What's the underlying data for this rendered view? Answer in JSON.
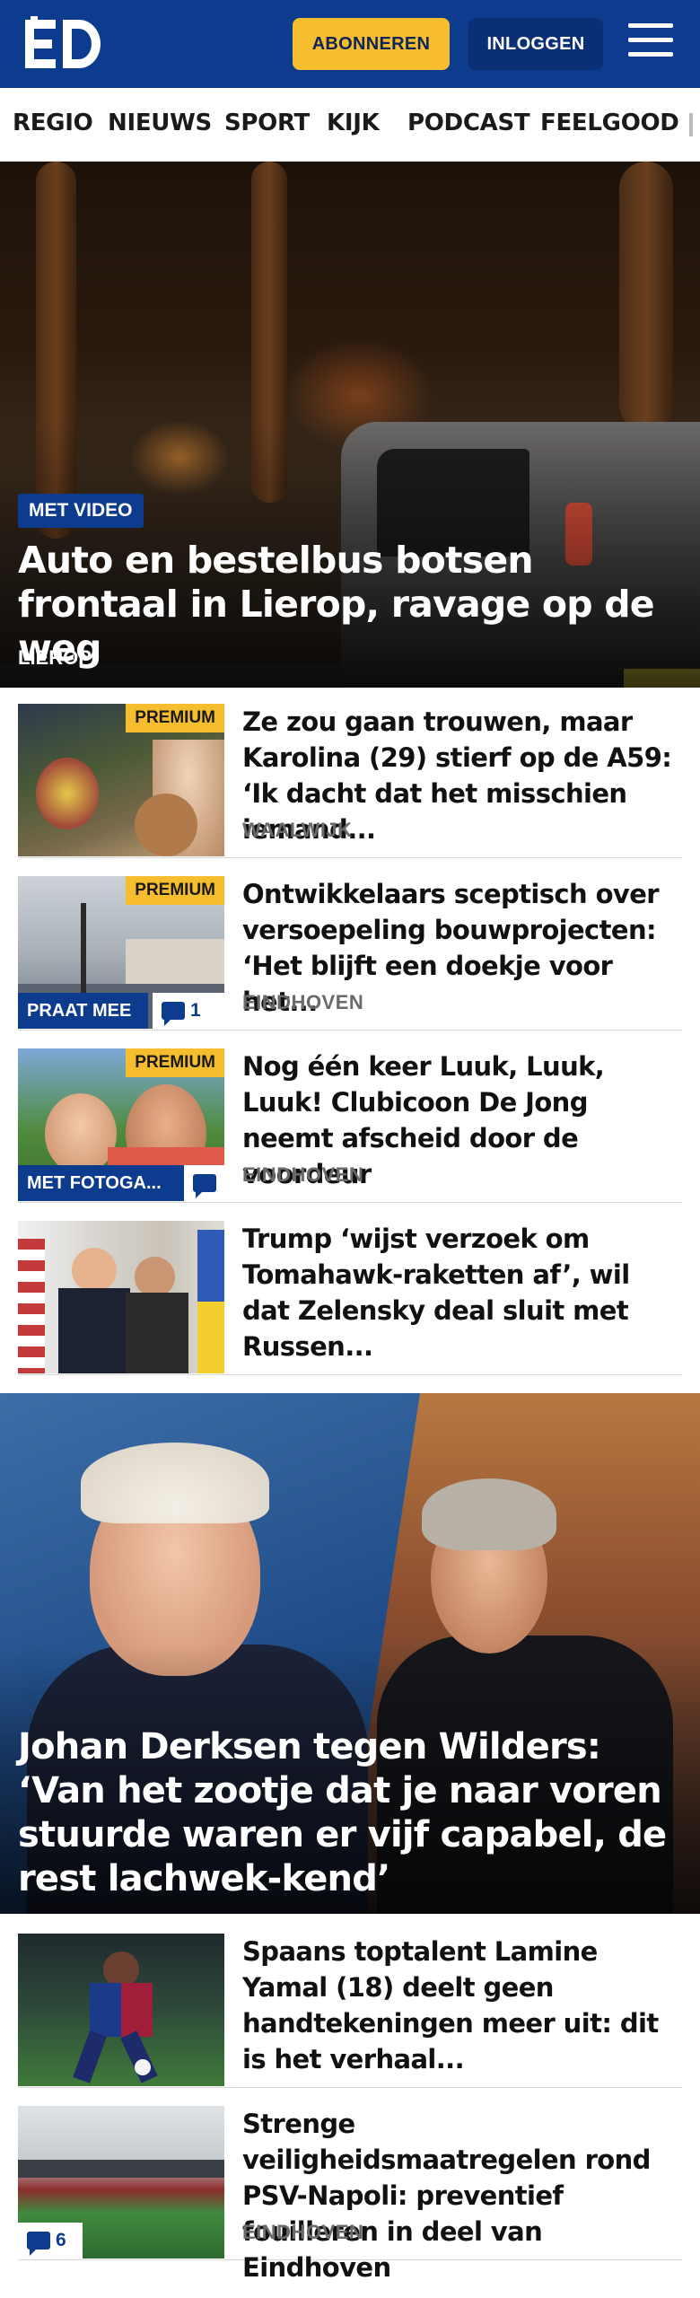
{
  "header": {
    "logo_text": "ED",
    "subscribe_label": "ABONNEREN",
    "login_label": "INLOGGEN"
  },
  "nav": {
    "items": [
      "REGIO",
      "NIEUWS",
      "SPORT",
      "KIJK",
      "PODCAST",
      "FEELGOOD"
    ]
  },
  "hero1": {
    "badge": "MET VIDEO",
    "title": "Auto en bestelbus botsen frontaal in Lierop, ravage op de weg",
    "location": "LIEROP"
  },
  "articles": [
    {
      "premium": "PREMIUM",
      "title": "Ze zou gaan trouwen, maar Karolina (29) stierf op de A59: ‘Ik dacht dat het misschien iemand...",
      "location": "WAALWIJK"
    },
    {
      "premium": "PREMIUM",
      "tag": "PRAAT MEE",
      "comments": "1",
      "title": "Ontwikkelaars sceptisch over versoepeling bouwprojecten: ‘Het blijft een doekje voor het...",
      "location": "EINDHOVEN"
    },
    {
      "premium": "PREMIUM",
      "tag": "MET FOTOGA...",
      "title": "Nog één keer Luuk, Luuk, Luuk! Clubicoon De Jong neemt afscheid door de voordeur",
      "location": "EINDHOVEN"
    },
    {
      "title": "Trump ‘wijst verzoek om Tomahawk-raketten af’, wil dat Zelensky deal sluit met Russen..."
    }
  ],
  "hero2": {
    "title": "Johan Derksen tegen Wilders: ‘Van het zootje dat je naar voren stuurde waren er vijf capabel, de rest lachwek-kend’"
  },
  "articles2": [
    {
      "title": "Spaans toptalent Lamine Yamal (18) deelt geen handtekeningen meer uit: dit is het verhaal..."
    },
    {
      "comments": "6",
      "title": "Strenge veiligheidsmaatregelen rond PSV-Napoli: preventief fouilleren in deel van Eindhoven",
      "location": "EINDHOVEN"
    }
  ],
  "colors": {
    "brand_blue": "#0d3c8f",
    "accent_yellow": "#f6bd2f"
  }
}
